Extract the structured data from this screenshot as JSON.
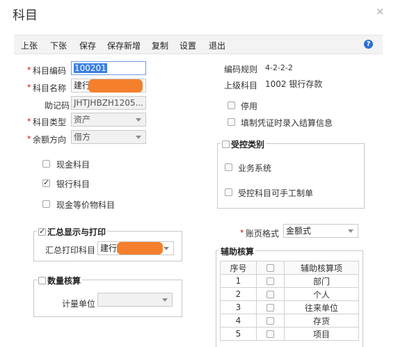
{
  "window": {
    "title": "科目"
  },
  "toolbar": {
    "items": [
      "上张",
      "下张",
      "保存",
      "保存新增",
      "复制",
      "设置",
      "退出"
    ],
    "help_icon": "help-icon"
  },
  "form": {
    "code": {
      "label": "科目编码",
      "value": "100201",
      "required": true
    },
    "name": {
      "label": "科目名称",
      "value": "建行",
      "required": true
    },
    "mnemonic": {
      "label": "助记码",
      "value": "JHTJHBZH1205..."
    },
    "type": {
      "label": "科目类型",
      "value": "资产",
      "required": true
    },
    "direction": {
      "label": "余额方向",
      "value": "借方",
      "required": true
    }
  },
  "right_info": {
    "rule_label": "编码规则",
    "rule_value": "4-2-2-2",
    "parent_label": "上级科目",
    "parent_value": "1002 银行存款",
    "disable_label": "停用",
    "settlement_label": "填制凭证时录入结算信息"
  },
  "options": [
    {
      "label": "现金科目",
      "checked": false
    },
    {
      "label": "银行科目",
      "checked": true
    },
    {
      "label": "现金等价物科目",
      "checked": false
    }
  ],
  "controlled": {
    "legend": "受控类别",
    "business": "业务系统",
    "manual": "受控科目可手工制单"
  },
  "summary": {
    "legend": "汇总显示与打印",
    "checked": true,
    "print_label": "汇总打印科目",
    "print_value": "建行"
  },
  "quantity": {
    "legend": "数量核算",
    "unit_label": "计量单位"
  },
  "ledger": {
    "label": "账页格式",
    "value": "金额式"
  },
  "aux": {
    "legend": "辅助核算",
    "headers": [
      "序号",
      "",
      "辅助核算项"
    ],
    "rows": [
      {
        "no": "1",
        "item": "部门"
      },
      {
        "no": "2",
        "item": "个人"
      },
      {
        "no": "3",
        "item": "往来单位"
      },
      {
        "no": "4",
        "item": "存货"
      },
      {
        "no": "5",
        "item": "项目"
      }
    ]
  },
  "colors": {
    "accent": "#3b7ee0",
    "required": "#d00000",
    "redaction": "#f47f2c"
  }
}
